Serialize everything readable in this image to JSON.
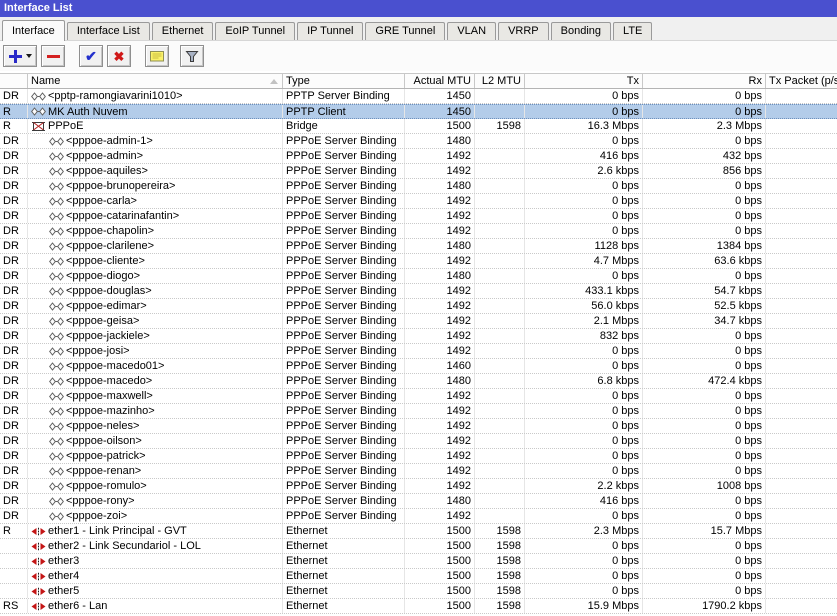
{
  "window": {
    "title": "Interface List"
  },
  "tabs": [
    {
      "label": "Interface",
      "active": true
    },
    {
      "label": "Interface List",
      "active": false
    },
    {
      "label": "Ethernet",
      "active": false
    },
    {
      "label": "EoIP Tunnel",
      "active": false
    },
    {
      "label": "IP Tunnel",
      "active": false
    },
    {
      "label": "GRE Tunnel",
      "active": false
    },
    {
      "label": "VLAN",
      "active": false
    },
    {
      "label": "VRRP",
      "active": false
    },
    {
      "label": "Bonding",
      "active": false
    },
    {
      "label": "LTE",
      "active": false
    }
  ],
  "toolbar": {
    "buttons": [
      {
        "id": "add",
        "icon": "plus-dropdown-icon"
      },
      {
        "id": "remove",
        "icon": "minus-icon"
      },
      {
        "id": "enable",
        "icon": "check-icon"
      },
      {
        "id": "disable",
        "icon": "cross-icon"
      },
      {
        "id": "comment",
        "icon": "note-icon"
      },
      {
        "id": "filter",
        "icon": "funnel-icon"
      }
    ]
  },
  "table": {
    "columns": [
      {
        "id": "flags",
        "label": ""
      },
      {
        "id": "name",
        "label": "Name",
        "sort": "asc"
      },
      {
        "id": "type",
        "label": "Type"
      },
      {
        "id": "actual_mtu",
        "label": "Actual MTU"
      },
      {
        "id": "l2_mtu",
        "label": "L2 MTU"
      },
      {
        "id": "tx",
        "label": "Tx"
      },
      {
        "id": "rx",
        "label": "Rx"
      },
      {
        "id": "tx_packet",
        "label": "Tx Packet (p/s"
      }
    ],
    "rows": [
      {
        "flags": "DR",
        "icon": "ppp",
        "indent": 0,
        "name": "<pptp-ramongiavarini1010>",
        "type": "PPTP Server Binding",
        "actual_mtu": "1450",
        "l2_mtu": "",
        "tx": "0 bps",
        "rx": "0 bps",
        "tx_packet": "",
        "selected": false
      },
      {
        "flags": "R",
        "icon": "ppp",
        "indent": 0,
        "name": "MK Auth Nuvem",
        "type": "PPTP Client",
        "actual_mtu": "1450",
        "l2_mtu": "",
        "tx": "0 bps",
        "rx": "0 bps",
        "tx_packet": "",
        "selected": true
      },
      {
        "flags": "R",
        "icon": "bridge",
        "indent": 0,
        "name": "PPPoE",
        "type": "Bridge",
        "actual_mtu": "1500",
        "l2_mtu": "1598",
        "tx": "16.3 Mbps",
        "rx": "2.3 Mbps",
        "tx_packet": "",
        "selected": false
      },
      {
        "flags": "DR",
        "icon": "ppp",
        "indent": 1,
        "name": "<pppoe-admin-1>",
        "type": "PPPoE Server Binding",
        "actual_mtu": "1480",
        "l2_mtu": "",
        "tx": "0 bps",
        "rx": "0 bps",
        "tx_packet": "",
        "selected": false
      },
      {
        "flags": "DR",
        "icon": "ppp",
        "indent": 1,
        "name": "<pppoe-admin>",
        "type": "PPPoE Server Binding",
        "actual_mtu": "1492",
        "l2_mtu": "",
        "tx": "416 bps",
        "rx": "432 bps",
        "tx_packet": "",
        "selected": false
      },
      {
        "flags": "DR",
        "icon": "ppp",
        "indent": 1,
        "name": "<pppoe-aquiles>",
        "type": "PPPoE Server Binding",
        "actual_mtu": "1492",
        "l2_mtu": "",
        "tx": "2.6 kbps",
        "rx": "856 bps",
        "tx_packet": "",
        "selected": false
      },
      {
        "flags": "DR",
        "icon": "ppp",
        "indent": 1,
        "name": "<pppoe-brunopereira>",
        "type": "PPPoE Server Binding",
        "actual_mtu": "1480",
        "l2_mtu": "",
        "tx": "0 bps",
        "rx": "0 bps",
        "tx_packet": "",
        "selected": false
      },
      {
        "flags": "DR",
        "icon": "ppp",
        "indent": 1,
        "name": "<pppoe-carla>",
        "type": "PPPoE Server Binding",
        "actual_mtu": "1492",
        "l2_mtu": "",
        "tx": "0 bps",
        "rx": "0 bps",
        "tx_packet": "",
        "selected": false
      },
      {
        "flags": "DR",
        "icon": "ppp",
        "indent": 1,
        "name": "<pppoe-catarinafantin>",
        "type": "PPPoE Server Binding",
        "actual_mtu": "1492",
        "l2_mtu": "",
        "tx": "0 bps",
        "rx": "0 bps",
        "tx_packet": "",
        "selected": false
      },
      {
        "flags": "DR",
        "icon": "ppp",
        "indent": 1,
        "name": "<pppoe-chapolin>",
        "type": "PPPoE Server Binding",
        "actual_mtu": "1492",
        "l2_mtu": "",
        "tx": "0 bps",
        "rx": "0 bps",
        "tx_packet": "",
        "selected": false
      },
      {
        "flags": "DR",
        "icon": "ppp",
        "indent": 1,
        "name": "<pppoe-clarilene>",
        "type": "PPPoE Server Binding",
        "actual_mtu": "1480",
        "l2_mtu": "",
        "tx": "1128 bps",
        "rx": "1384 bps",
        "tx_packet": "",
        "selected": false
      },
      {
        "flags": "DR",
        "icon": "ppp",
        "indent": 1,
        "name": "<pppoe-cliente>",
        "type": "PPPoE Server Binding",
        "actual_mtu": "1492",
        "l2_mtu": "",
        "tx": "4.7 Mbps",
        "rx": "63.6 kbps",
        "tx_packet": "",
        "selected": false
      },
      {
        "flags": "DR",
        "icon": "ppp",
        "indent": 1,
        "name": "<pppoe-diogo>",
        "type": "PPPoE Server Binding",
        "actual_mtu": "1480",
        "l2_mtu": "",
        "tx": "0 bps",
        "rx": "0 bps",
        "tx_packet": "",
        "selected": false
      },
      {
        "flags": "DR",
        "icon": "ppp",
        "indent": 1,
        "name": "<pppoe-douglas>",
        "type": "PPPoE Server Binding",
        "actual_mtu": "1492",
        "l2_mtu": "",
        "tx": "433.1 kbps",
        "rx": "54.7 kbps",
        "tx_packet": "",
        "selected": false
      },
      {
        "flags": "DR",
        "icon": "ppp",
        "indent": 1,
        "name": "<pppoe-edimar>",
        "type": "PPPoE Server Binding",
        "actual_mtu": "1492",
        "l2_mtu": "",
        "tx": "56.0 kbps",
        "rx": "52.5 kbps",
        "tx_packet": "",
        "selected": false
      },
      {
        "flags": "DR",
        "icon": "ppp",
        "indent": 1,
        "name": "<pppoe-geisa>",
        "type": "PPPoE Server Binding",
        "actual_mtu": "1492",
        "l2_mtu": "",
        "tx": "2.1 Mbps",
        "rx": "34.7 kbps",
        "tx_packet": "",
        "selected": false
      },
      {
        "flags": "DR",
        "icon": "ppp",
        "indent": 1,
        "name": "<pppoe-jackiele>",
        "type": "PPPoE Server Binding",
        "actual_mtu": "1492",
        "l2_mtu": "",
        "tx": "832 bps",
        "rx": "0 bps",
        "tx_packet": "",
        "selected": false
      },
      {
        "flags": "DR",
        "icon": "ppp",
        "indent": 1,
        "name": "<pppoe-josi>",
        "type": "PPPoE Server Binding",
        "actual_mtu": "1492",
        "l2_mtu": "",
        "tx": "0 bps",
        "rx": "0 bps",
        "tx_packet": "",
        "selected": false
      },
      {
        "flags": "DR",
        "icon": "ppp",
        "indent": 1,
        "name": "<pppoe-macedo01>",
        "type": "PPPoE Server Binding",
        "actual_mtu": "1460",
        "l2_mtu": "",
        "tx": "0 bps",
        "rx": "0 bps",
        "tx_packet": "",
        "selected": false
      },
      {
        "flags": "DR",
        "icon": "ppp",
        "indent": 1,
        "name": "<pppoe-macedo>",
        "type": "PPPoE Server Binding",
        "actual_mtu": "1480",
        "l2_mtu": "",
        "tx": "6.8 kbps",
        "rx": "472.4 kbps",
        "tx_packet": "",
        "selected": false
      },
      {
        "flags": "DR",
        "icon": "ppp",
        "indent": 1,
        "name": "<pppoe-maxwell>",
        "type": "PPPoE Server Binding",
        "actual_mtu": "1492",
        "l2_mtu": "",
        "tx": "0 bps",
        "rx": "0 bps",
        "tx_packet": "",
        "selected": false
      },
      {
        "flags": "DR",
        "icon": "ppp",
        "indent": 1,
        "name": "<pppoe-mazinho>",
        "type": "PPPoE Server Binding",
        "actual_mtu": "1492",
        "l2_mtu": "",
        "tx": "0 bps",
        "rx": "0 bps",
        "tx_packet": "",
        "selected": false
      },
      {
        "flags": "DR",
        "icon": "ppp",
        "indent": 1,
        "name": "<pppoe-neles>",
        "type": "PPPoE Server Binding",
        "actual_mtu": "1492",
        "l2_mtu": "",
        "tx": "0 bps",
        "rx": "0 bps",
        "tx_packet": "",
        "selected": false
      },
      {
        "flags": "DR",
        "icon": "ppp",
        "indent": 1,
        "name": "<pppoe-oilson>",
        "type": "PPPoE Server Binding",
        "actual_mtu": "1492",
        "l2_mtu": "",
        "tx": "0 bps",
        "rx": "0 bps",
        "tx_packet": "",
        "selected": false
      },
      {
        "flags": "DR",
        "icon": "ppp",
        "indent": 1,
        "name": "<pppoe-patrick>",
        "type": "PPPoE Server Binding",
        "actual_mtu": "1492",
        "l2_mtu": "",
        "tx": "0 bps",
        "rx": "0 bps",
        "tx_packet": "",
        "selected": false
      },
      {
        "flags": "DR",
        "icon": "ppp",
        "indent": 1,
        "name": "<pppoe-renan>",
        "type": "PPPoE Server Binding",
        "actual_mtu": "1492",
        "l2_mtu": "",
        "tx": "0 bps",
        "rx": "0 bps",
        "tx_packet": "",
        "selected": false
      },
      {
        "flags": "DR",
        "icon": "ppp",
        "indent": 1,
        "name": "<pppoe-romulo>",
        "type": "PPPoE Server Binding",
        "actual_mtu": "1492",
        "l2_mtu": "",
        "tx": "2.2 kbps",
        "rx": "1008 bps",
        "tx_packet": "",
        "selected": false
      },
      {
        "flags": "DR",
        "icon": "ppp",
        "indent": 1,
        "name": "<pppoe-rony>",
        "type": "PPPoE Server Binding",
        "actual_mtu": "1480",
        "l2_mtu": "",
        "tx": "416 bps",
        "rx": "0 bps",
        "tx_packet": "",
        "selected": false
      },
      {
        "flags": "DR",
        "icon": "ppp",
        "indent": 1,
        "name": "<pppoe-zoi>",
        "type": "PPPoE Server Binding",
        "actual_mtu": "1492",
        "l2_mtu": "",
        "tx": "0 bps",
        "rx": "0 bps",
        "tx_packet": "",
        "selected": false
      },
      {
        "flags": "R",
        "icon": "ethernet",
        "indent": 0,
        "name": "ether1 - Link Principal - GVT",
        "type": "Ethernet",
        "actual_mtu": "1500",
        "l2_mtu": "1598",
        "tx": "2.3 Mbps",
        "rx": "15.7 Mbps",
        "tx_packet": "",
        "selected": false
      },
      {
        "flags": "",
        "icon": "ethernet",
        "indent": 0,
        "name": "ether2 - Link Secundariol - LOL",
        "type": "Ethernet",
        "actual_mtu": "1500",
        "l2_mtu": "1598",
        "tx": "0 bps",
        "rx": "0 bps",
        "tx_packet": "",
        "selected": false
      },
      {
        "flags": "",
        "icon": "ethernet",
        "indent": 0,
        "name": "ether3",
        "type": "Ethernet",
        "actual_mtu": "1500",
        "l2_mtu": "1598",
        "tx": "0 bps",
        "rx": "0 bps",
        "tx_packet": "",
        "selected": false
      },
      {
        "flags": "",
        "icon": "ethernet",
        "indent": 0,
        "name": "ether4",
        "type": "Ethernet",
        "actual_mtu": "1500",
        "l2_mtu": "1598",
        "tx": "0 bps",
        "rx": "0 bps",
        "tx_packet": "",
        "selected": false
      },
      {
        "flags": "",
        "icon": "ethernet",
        "indent": 0,
        "name": "ether5",
        "type": "Ethernet",
        "actual_mtu": "1500",
        "l2_mtu": "1598",
        "tx": "0 bps",
        "rx": "0 bps",
        "tx_packet": "",
        "selected": false
      },
      {
        "flags": "RS",
        "icon": "ethernet",
        "indent": 0,
        "name": "ether6 - Lan",
        "type": "Ethernet",
        "actual_mtu": "1500",
        "l2_mtu": "1598",
        "tx": "15.9 Mbps",
        "rx": "1790.2 kbps",
        "tx_packet": "",
        "selected": false
      }
    ]
  },
  "colors": {
    "titlebar": "#4a50cf",
    "selection": "#b3cce9",
    "accent_blue": "#2a2ac8",
    "accent_red": "#d42020",
    "note_yellow": "#faf169"
  }
}
